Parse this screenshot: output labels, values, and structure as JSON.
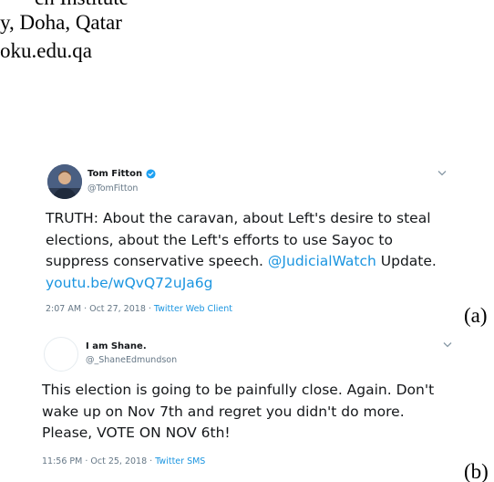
{
  "paper": {
    "affiliation_lines": [
      "ch Institute",
      "y, Doha, Qatar",
      "oku.edu.qa"
    ]
  },
  "tweets": [
    {
      "display_name": "Tom Fitton",
      "handle": "@TomFitton",
      "verified": true,
      "text_lines": [
        "TRUTH:  About the caravan, about Left's desire to steal",
        "elections, about the  Left's efforts to use Sayoc to",
        "suppress conservative speech. "
      ],
      "mention": "@JudicialWatch",
      "after_mention": " Update.",
      "url": "youtu.be/wQvQ72uJa6g",
      "timestamp": "2:07 AM · Oct 27, 2018 · ",
      "source": "Twitter Web Client",
      "label": "(a)"
    },
    {
      "display_name": "I am Shane.",
      "handle": "@_ShaneEdmundson",
      "verified": false,
      "text_lines": [
        "This election is going to be painfully close. Again. Don't",
        "wake up on Nov 7th and regret you didn't do more.",
        "Please, VOTE ON NOV 6th!"
      ],
      "timestamp": "11:56 PM · Oct 25, 2018 · ",
      "source": "Twitter SMS",
      "label": "(b)"
    }
  ],
  "colors": {
    "link": "#1b95e0",
    "verified_badge": "#1da1f2",
    "secondary_text": "#657786"
  },
  "icons": {
    "verified": "verified-badge-icon",
    "menu": "chevron-down-icon"
  }
}
